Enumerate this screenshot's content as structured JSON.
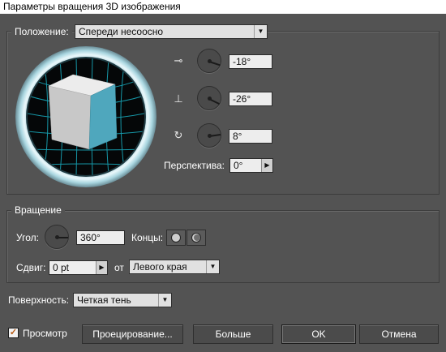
{
  "window": {
    "title": "Параметры вращения 3D изображения"
  },
  "position": {
    "label": "Положение:",
    "value": "Спереди несоосно",
    "x_angle": "-18°",
    "y_angle": "-26°",
    "z_angle": "8°",
    "x_rotation_deg": -18,
    "y_rotation_deg": -26,
    "z_rotation_deg": 8,
    "perspective_label": "Перспектива:",
    "perspective_value": "0°"
  },
  "rotation": {
    "legend": "Вращение",
    "angle_label": "Угол:",
    "angle_value": "360°",
    "angle_deg": 360,
    "caps_label": "Концы:",
    "offset_label": "Сдвиг:",
    "offset_value": "0 pt",
    "from_label": "от",
    "from_value": "Левого края"
  },
  "surface": {
    "label": "Поверхность:",
    "value": "Четкая тень"
  },
  "buttons": {
    "preview_label": "Просмотр",
    "preview_checked": true,
    "map_label": "Проецирование...",
    "more_label": "Больше",
    "ok_label": "OK",
    "cancel_label": "Отмена"
  },
  "icons": {
    "x_axis": "rotate-x-axis-icon",
    "y_axis": "rotate-y-axis-icon",
    "z_axis": "rotate-z-axis-icon",
    "cap_on": "cap-on-icon",
    "cap_off": "cap-off-icon",
    "dropdown": "chevron-down-icon",
    "stepper": "chevron-right-icon"
  },
  "colors": {
    "cube_front": "#4fa7bd",
    "cube_side": "#c8c8c8",
    "cube_top": "#ececec",
    "grid": "#1ab1c4",
    "ring": "#cfe8ef"
  }
}
